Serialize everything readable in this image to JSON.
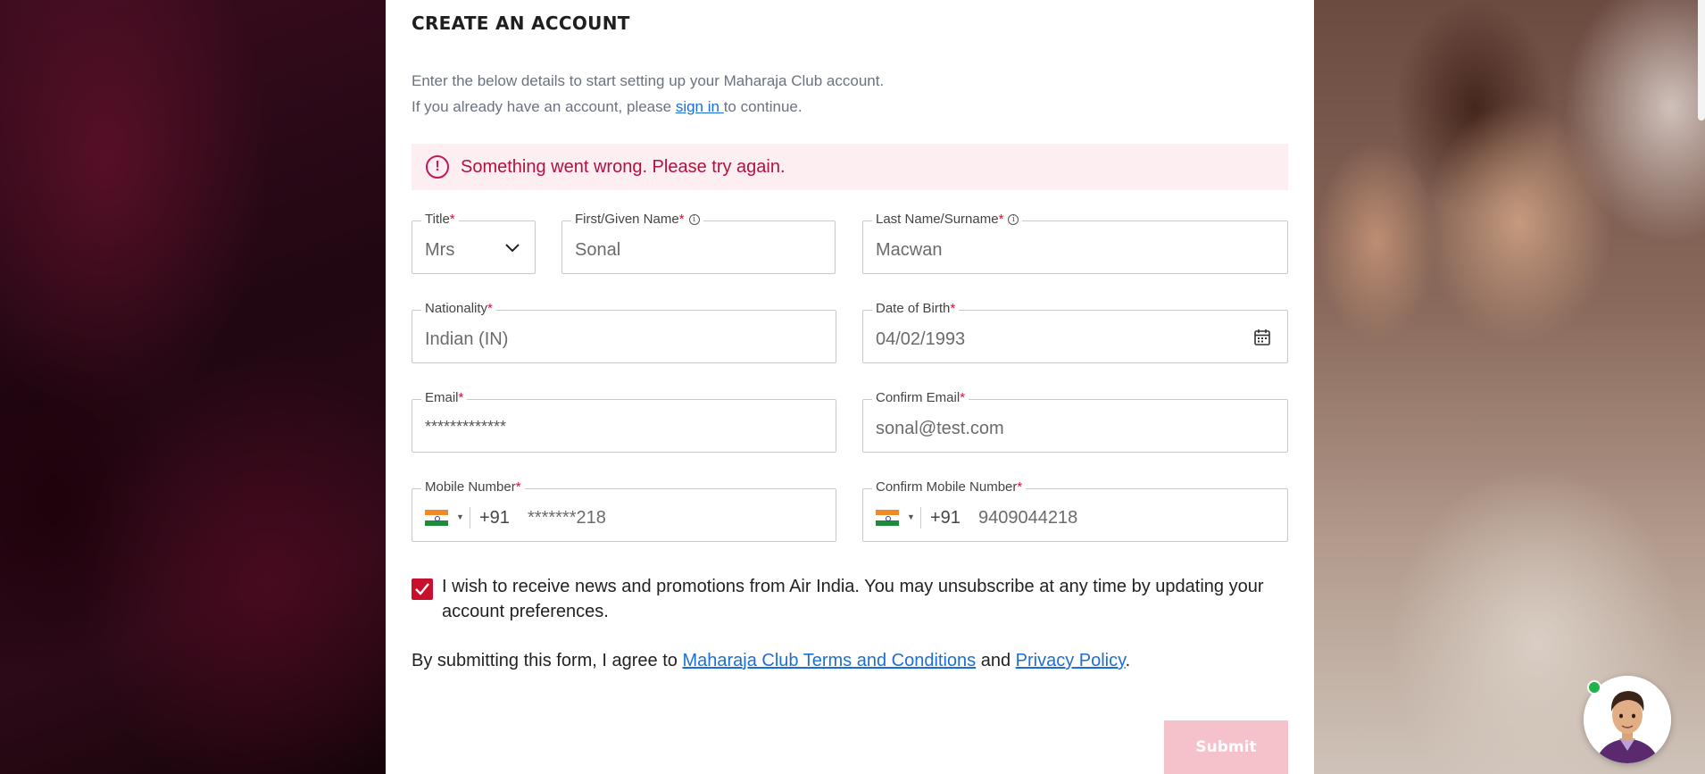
{
  "form": {
    "heading": "CREATE AN ACCOUNT",
    "intro_line1": "Enter the below details to start setting up your Maharaja Club account.",
    "intro_line2_prefix": "If you already have an account, please ",
    "intro_link": "sign in ",
    "intro_line2_suffix": "to continue.",
    "error_message": "Something went wrong. Please try again."
  },
  "fields": {
    "title": {
      "label": "Title",
      "value": "Mrs"
    },
    "first_name": {
      "label": "First/Given Name",
      "value": "Sonal"
    },
    "last_name": {
      "label": "Last Name/Surname",
      "value": "Macwan"
    },
    "nationality": {
      "label": "Nationality",
      "value": "Indian (IN)"
    },
    "dob": {
      "label": "Date of Birth",
      "value": "04/02/1993"
    },
    "email": {
      "label": "Email",
      "value": "*************"
    },
    "confirm_email": {
      "label": "Confirm Email",
      "value": "sonal@test.com"
    },
    "mobile": {
      "label": "Mobile Number",
      "country_code": "+91",
      "value": "*******218"
    },
    "confirm_mobile": {
      "label": "Confirm Mobile Number",
      "country_code": "+91",
      "value": "9409044218"
    }
  },
  "required_mark": "*",
  "consent": {
    "checked": true,
    "text": "I wish to receive news and promotions from Air India. You may unsubscribe at any time by updating your account preferences."
  },
  "terms": {
    "prefix": "By submitting this form, I agree to ",
    "terms_link": "Maharaja Club Terms and Conditions",
    "middle": " and ",
    "privacy_link": "Privacy Policy",
    "suffix": "."
  },
  "submit_label": "Submit",
  "colors": {
    "accent": "#c8102e",
    "link": "#1a6fd6",
    "error_bg": "#fdeef1",
    "submit_disabled": "#f5c2cc"
  },
  "icons": {
    "error": "alert-circle-icon",
    "dropdown": "chevron-down-icon",
    "calendar": "calendar-icon",
    "info": "info-icon",
    "flag": "india-flag-icon",
    "check": "check-icon"
  }
}
